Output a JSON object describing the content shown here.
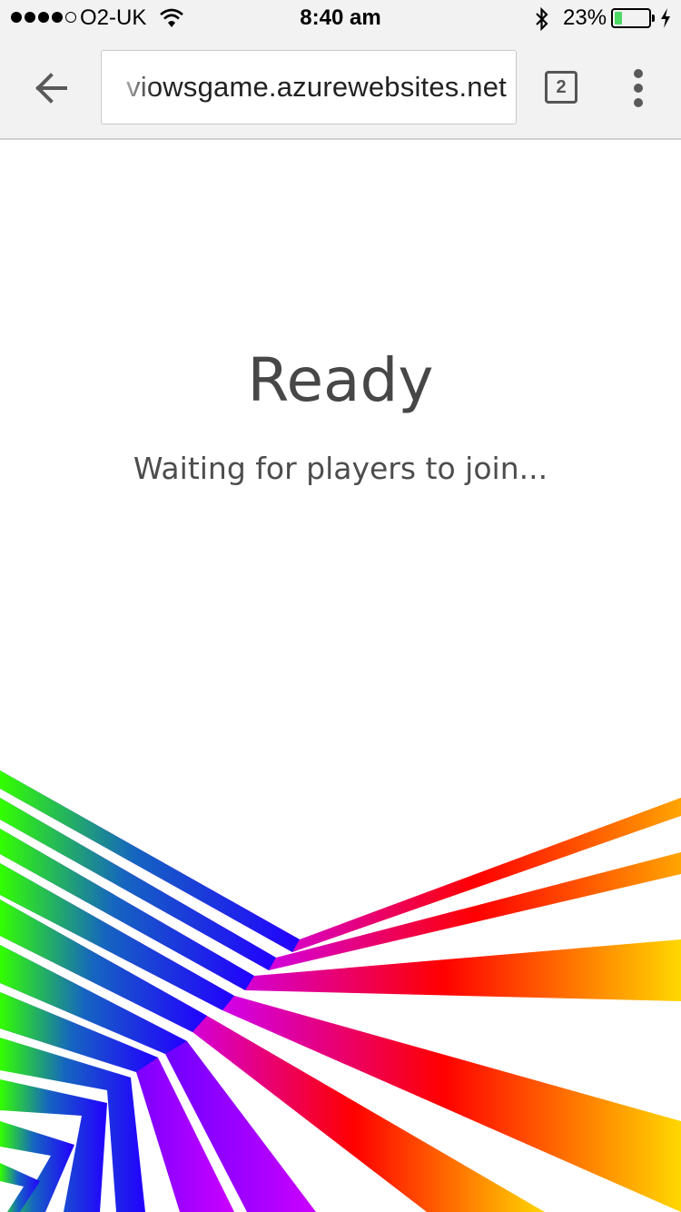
{
  "status_bar": {
    "carrier": "O2-UK",
    "signal_bars_filled": 4,
    "signal_bars_total": 5,
    "time": "8:40 am",
    "battery_percent_label": "23%",
    "battery_level": 0.23,
    "icons": [
      "signal-dots-icon",
      "wifi-icon",
      "bluetooth-icon",
      "battery-icon",
      "charging-icon"
    ]
  },
  "browser": {
    "url": "viowsgame.azurewebsites.net",
    "tab_count": "2",
    "icons": [
      "back-arrow-icon",
      "tabs-icon",
      "overflow-menu-icon"
    ]
  },
  "page": {
    "title": "Ready",
    "subtitle": "Waiting for players to join..."
  },
  "colors": {
    "toolbar_bg": "#f2f2f2",
    "text_primary": "#474747",
    "battery_green": "#4cd964",
    "ribbon_palette": [
      "#33ff00",
      "#0000ff",
      "#cc00ff",
      "#ff0000",
      "#ffd700"
    ]
  }
}
